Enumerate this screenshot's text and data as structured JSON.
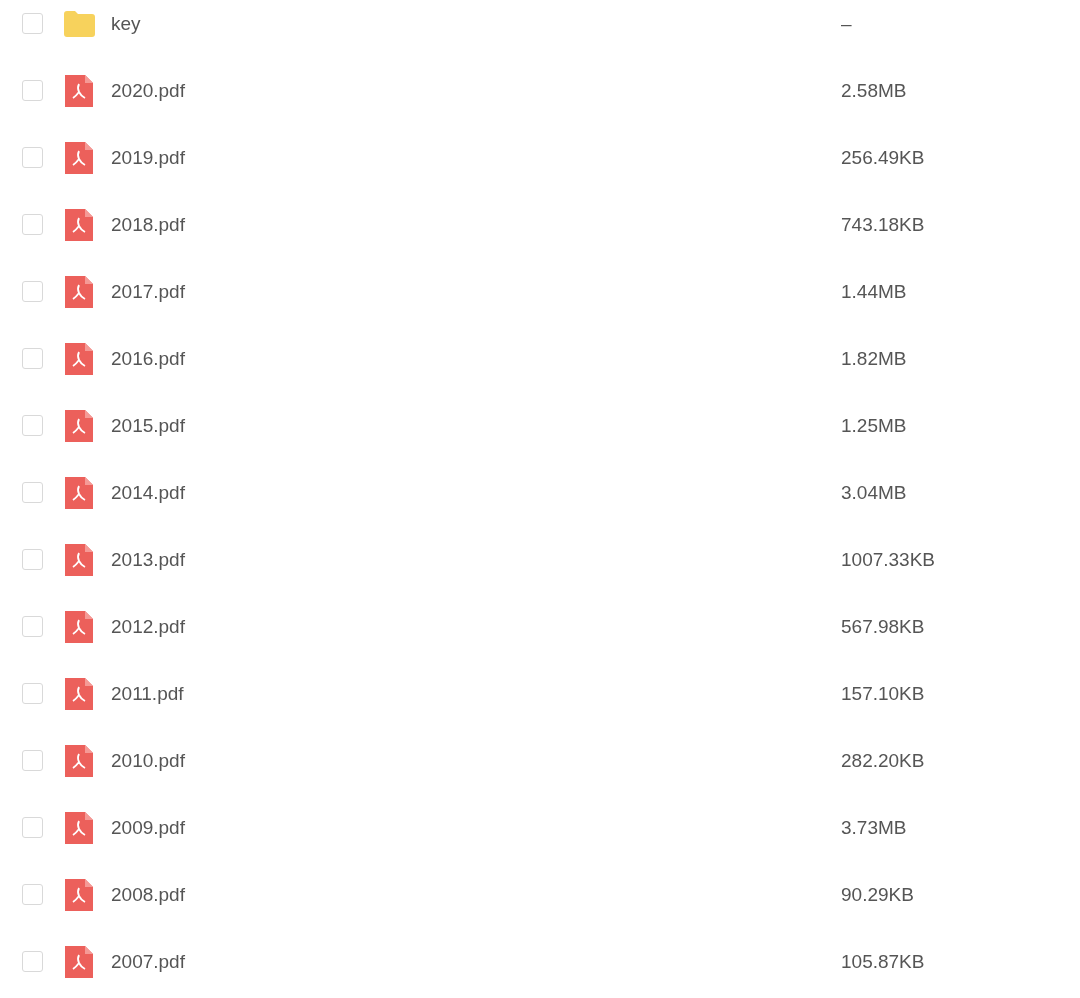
{
  "files": [
    {
      "kind": "folder",
      "name": "key",
      "size": "–",
      "checked": false
    },
    {
      "kind": "pdf",
      "name": "2020.pdf",
      "size": "2.58MB",
      "checked": false
    },
    {
      "kind": "pdf",
      "name": "2019.pdf",
      "size": "256.49KB",
      "checked": false
    },
    {
      "kind": "pdf",
      "name": "2018.pdf",
      "size": "743.18KB",
      "checked": false
    },
    {
      "kind": "pdf",
      "name": "2017.pdf",
      "size": "1.44MB",
      "checked": false
    },
    {
      "kind": "pdf",
      "name": "2016.pdf",
      "size": "1.82MB",
      "checked": false
    },
    {
      "kind": "pdf",
      "name": "2015.pdf",
      "size": "1.25MB",
      "checked": false
    },
    {
      "kind": "pdf",
      "name": "2014.pdf",
      "size": "3.04MB",
      "checked": false
    },
    {
      "kind": "pdf",
      "name": "2013.pdf",
      "size": "1007.33KB",
      "checked": false
    },
    {
      "kind": "pdf",
      "name": "2012.pdf",
      "size": "567.98KB",
      "checked": false
    },
    {
      "kind": "pdf",
      "name": "2011.pdf",
      "size": "157.10KB",
      "checked": false
    },
    {
      "kind": "pdf",
      "name": "2010.pdf",
      "size": "282.20KB",
      "checked": false
    },
    {
      "kind": "pdf",
      "name": "2009.pdf",
      "size": "3.73MB",
      "checked": false
    },
    {
      "kind": "pdf",
      "name": "2008.pdf",
      "size": "90.29KB",
      "checked": false
    },
    {
      "kind": "pdf",
      "name": "2007.pdf",
      "size": "105.87KB",
      "checked": false
    }
  ]
}
